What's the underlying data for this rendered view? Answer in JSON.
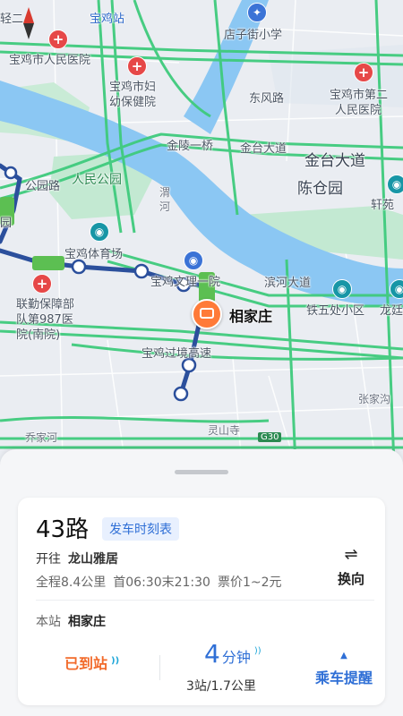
{
  "map": {
    "labels": {
      "baoji_station": "宝鸡站",
      "dianzijie_school": "店子街小学",
      "people_hospital": "宝鸡市人民医院",
      "maternal_hospital_1": "宝鸡市妇",
      "maternal_hospital_2": "幼保健院",
      "dongfeng_road": "东风路",
      "second_hospital_1": "宝鸡市第二",
      "second_hospital_2": "人民医院",
      "jinling_bridge": "金陵一桥",
      "jintai_avenue": "金台大道",
      "jintai_avenue_big": "金台大道",
      "chencang_park": "陈仓园",
      "xuanyuan": "轩苑",
      "peoples_park": "人民公园",
      "park_road": "公园路",
      "wei_river_1": "渭",
      "wei_river_2": "河",
      "stadium": "宝鸡体育场",
      "baoji_mid_hospital": "宝鸡文理一院",
      "binhe_avenue": "滨河大道",
      "tiewu_district": "铁五处小区",
      "longting": "龙廷",
      "lianqin_1": "联勤保障部",
      "lianqin_2": "队第987医",
      "lianqin_3": "院(南院)",
      "xiangjiazhuang_stop": "相家庄",
      "guojing_highway": "宝鸡过境高速",
      "zhangjia": "张家沟",
      "qiaohe": "乔家河",
      "lingshan_temple": "灵山寺",
      "g30": "G30",
      "top_left": "轻二",
      "yuan": "园"
    },
    "hospital_icon": "hospital-cross-icon",
    "colors": {
      "water": "#8bc7f3",
      "green": "#c3e9d2",
      "road": "#3fcb7d",
      "route": "#2b4f9c",
      "route_vehicle": "#5cbf52",
      "stop_marker": "#ff7a38"
    }
  },
  "sheet": {
    "route_no": "43路",
    "timetable_label": "发车时刻表",
    "towards_label": "开往",
    "destination": "龙山雅居",
    "total_distance": "全程8.4公里",
    "hours": "首06:30末21:30",
    "fare": "票价1~2元",
    "switch_icon": "⇌",
    "switch_label": "换向",
    "station_label": "本站",
    "station_name": "相家庄",
    "arrived_label": "已到站",
    "eta_minutes": "4",
    "eta_unit": "分钟",
    "stops_distance": "3站/1.7公里",
    "remind_label": "乘车提醒"
  }
}
